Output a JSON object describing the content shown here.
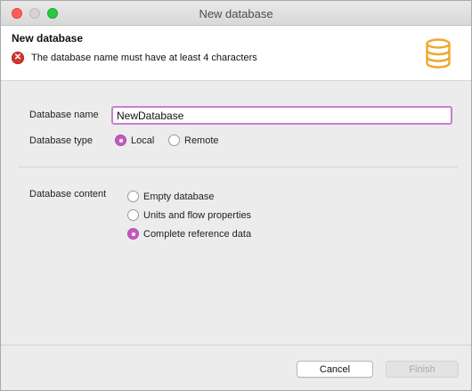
{
  "window": {
    "title": "New database"
  },
  "header": {
    "title": "New database",
    "error_message": "The database name must have at least 4 characters",
    "error_icon": "error-x-icon",
    "banner_icon": "database-icon"
  },
  "form": {
    "name_label": "Database name",
    "name_value": "NewDatabase",
    "type_label": "Database type",
    "type_options": [
      {
        "label": "Local",
        "selected": true
      },
      {
        "label": "Remote",
        "selected": false
      }
    ],
    "content_label": "Database content",
    "content_options": [
      {
        "label": "Empty database",
        "selected": false
      },
      {
        "label": "Units and flow properties",
        "selected": false
      },
      {
        "label": "Complete reference data",
        "selected": true
      }
    ]
  },
  "buttons": {
    "cancel": "Cancel",
    "finish": "Finish"
  },
  "colors": {
    "accent": "#c35bbf",
    "error": "#d2352f",
    "db_icon": "#f0a72a"
  }
}
